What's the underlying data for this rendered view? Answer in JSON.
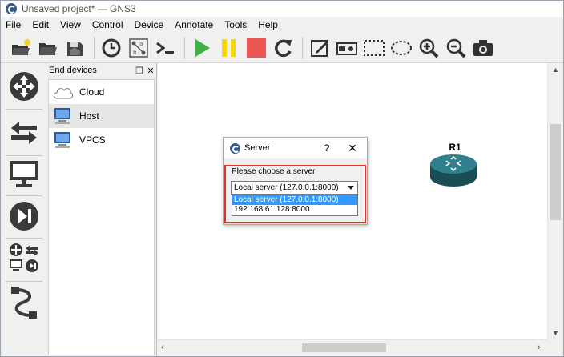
{
  "window": {
    "title": "Unsaved project* — GNS3"
  },
  "menu": [
    "File",
    "Edit",
    "View",
    "Control",
    "Device",
    "Annotate",
    "Tools",
    "Help"
  ],
  "toolbar": [
    {
      "icon": "open-folder-new-icon"
    },
    {
      "icon": "open-folder-icon"
    },
    {
      "icon": "save-icon"
    },
    {
      "icon": "snapshot-clock-icon"
    },
    {
      "icon": "show-interface-labels-icon"
    },
    {
      "icon": "console-icon"
    },
    {
      "icon": "start-play-icon"
    },
    {
      "icon": "suspend-pause-icon"
    },
    {
      "icon": "stop-icon"
    },
    {
      "icon": "reload-icon"
    },
    {
      "icon": "add-note-icon"
    },
    {
      "icon": "insert-picture-icon"
    },
    {
      "icon": "draw-rectangle-icon"
    },
    {
      "icon": "draw-ellipse-icon"
    },
    {
      "icon": "zoom-in-icon"
    },
    {
      "icon": "zoom-out-icon"
    },
    {
      "icon": "screenshot-camera-icon"
    }
  ],
  "dock": {
    "title": "End devices",
    "items": [
      {
        "label": "Cloud",
        "icon": "cloud-icon"
      },
      {
        "label": "Host",
        "icon": "host-computer-icon"
      },
      {
        "label": "VPCS",
        "icon": "vpcs-computer-icon"
      }
    ]
  },
  "canvas": {
    "router_label": "R1"
  },
  "dialog": {
    "title": "Server",
    "help": "?",
    "close": "✕",
    "prompt": "Please choose a server",
    "selected": "Local server (127.0.0.1:8000)",
    "options": [
      "Local server (127.0.0.1:8000)",
      "192.168.61.128:8000"
    ]
  },
  "colors": {
    "highlight": "#e0312b",
    "selection": "#3399ff",
    "start": "#3cb043",
    "pause": "#f5d800",
    "stop": "#ee5555"
  }
}
